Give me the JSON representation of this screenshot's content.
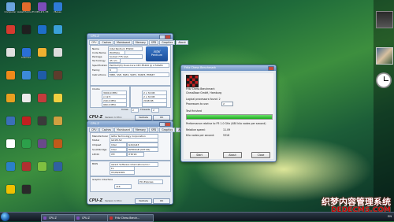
{
  "desktop_icons": [
    {
      "label": "Computer",
      "color": "#6aa4df"
    },
    {
      "label": "Avast Home Edition",
      "color": "#e46b2c"
    },
    {
      "label": "CPU-Z 1.53",
      "color": "#7b4db8"
    },
    {
      "label": "iTunes",
      "color": "#2e7bd6"
    },
    {
      "label": "",
      "color": "#d63a2f"
    },
    {
      "label": "",
      "color": "#1f1f1f"
    },
    {
      "label": "",
      "color": "#1e6ec9"
    },
    {
      "label": "",
      "color": "#3aa0d8"
    },
    {
      "label": "",
      "color": "#e0e0e0"
    },
    {
      "label": "Internet",
      "color": "#2a6fd6"
    },
    {
      "label": "",
      "color": "#f0b030"
    },
    {
      "label": "",
      "color": "#dcdcdc"
    },
    {
      "label": "",
      "color": "#f08a1a"
    },
    {
      "label": "",
      "color": "#3c8ad8"
    },
    {
      "label": "",
      "color": "#1f5ca8"
    },
    {
      "label": "",
      "color": "#5c3c2c"
    },
    {
      "label": "",
      "color": "#e8a020"
    },
    {
      "label": "",
      "color": "#eaeaea"
    },
    {
      "label": "",
      "color": "#c43c3c"
    },
    {
      "label": "",
      "color": "#f0d040"
    },
    {
      "label": "",
      "color": "#3a6fb8"
    },
    {
      "label": "",
      "color": "#c02020"
    },
    {
      "label": "",
      "color": "#3a3a3a"
    },
    {
      "label": "",
      "color": "#d0a040"
    },
    {
      "label": "",
      "color": "#ffffff"
    },
    {
      "label": "",
      "color": "#2ca04a"
    },
    {
      "label": "",
      "color": "#6a4a8a"
    },
    {
      "label": "",
      "color": "#c05a1a"
    },
    {
      "label": "",
      "color": "#2a80c8"
    },
    {
      "label": "",
      "color": "#b03030"
    },
    {
      "label": "",
      "color": "#80c040"
    },
    {
      "label": "",
      "color": "#3060a0"
    },
    {
      "label": "",
      "color": "#f0c000"
    },
    {
      "label": "",
      "color": "#2a2a2a"
    }
  ],
  "cpuz_top": {
    "title": "CPU-Z",
    "tabs": [
      "CPU",
      "Caches",
      "Mainboard",
      "Memory",
      "SPD",
      "Graphics",
      "About"
    ],
    "logo_top": "intel",
    "logo_bottom": "Pentium",
    "name_label": "Name",
    "name_value": "Intel Pentium E5200",
    "codename_label": "Code Name",
    "codename_value": "Wolfdale",
    "package_label": "Package",
    "package_value": "Socket 775 LGA",
    "technology_label": "Technology",
    "technology_value": "45 nm",
    "spec_label": "Specification",
    "spec_value": "Pentium(R) Dual-Core CPU E5200 @ 2.50GHz",
    "family_label": "Family",
    "family_value": "6",
    "instructions_label": "Instructions",
    "instructions_value": "MMX, SSE, SSE2, SSE3, SSSE3, EM64T",
    "clocks_label": "Clocks",
    "core_speed": "3000.0 MHz",
    "multiplier": "x 12.5",
    "bus_speed": "240.0 MHz",
    "rated_fsb": "960.0 MHz",
    "l1d": "2 x 32 KB",
    "l1i": "2 x 32 KB",
    "l2": "2048 KB",
    "l3": "",
    "cores_label": "Cores",
    "cores_value": "2",
    "threads_label": "Threads",
    "threads_value": "2",
    "brand": "CPU-Z",
    "version": "Version 1.53.1",
    "validate_btn": "Validate",
    "ok_btn": "OK"
  },
  "cpuz_bottom": {
    "title": "CPU-Z",
    "tabs": [
      "CPU",
      "Caches",
      "Mainboard",
      "Memory",
      "SPD",
      "Graphics",
      "About"
    ],
    "manufacturer_label": "Manufacturer",
    "manufacturer_value": "Gitte Technology Corporation",
    "model_label": "Model",
    "model_value": "G41M-S2",
    "chipset_label": "Chipset",
    "chipset_value": "Intel",
    "chipset_name": "G41/G43",
    "southbridge_label": "Southbridge",
    "southbridge_value": "Intel",
    "southbridge_name": "82801GB (ICH7/R)",
    "lpcio_label": "LPCIO",
    "lpcio_value": "ITE",
    "lpcio_name": "IT8718",
    "bios_label": "BIOS",
    "bios_brand": "Award Software International Inc.",
    "bios_version": "F1",
    "bios_date": "05/06/2009",
    "graphic_label": "Graphic Interface",
    "graphic_version": "PCI-Express",
    "link_width": "x16",
    "brand": "CPU-Z",
    "version": "Version 1.53.1",
    "validate_btn": "Validate",
    "ok_btn": "OK"
  },
  "chess": {
    "title": "Fritz Chess Benchmark",
    "app_name": "Fritz Chess Benchmark",
    "company": "ChessBase GmbH, Hamburg",
    "logical_label": "Logical processors found: 2",
    "processors_label": "Processors to use:",
    "processors_value": "2",
    "status": "Test finished",
    "progress": 1.0,
    "perf_label": "Performance relative to P3 1.0 GHz (480 kilo nodes per second)",
    "speed_label": "Relative speed:",
    "speed_value": "11.09",
    "knodes_label": "Kilo nodes per second:",
    "knodes_value": "5316",
    "start_btn": "Start",
    "about_btn": "About",
    "close_btn": "Close"
  },
  "taskbar": {
    "items": [
      {
        "label": "CPU-Z",
        "color": "#7b4db8"
      },
      {
        "label": "CPU-Z",
        "color": "#7b4db8"
      },
      {
        "label": "Fritz Chess Bench...",
        "color": "#c03030"
      }
    ],
    "tray_text": "EN"
  },
  "watermark_line1": "织梦内容管理系统",
  "watermark_line2": "DEDECMS.COM"
}
